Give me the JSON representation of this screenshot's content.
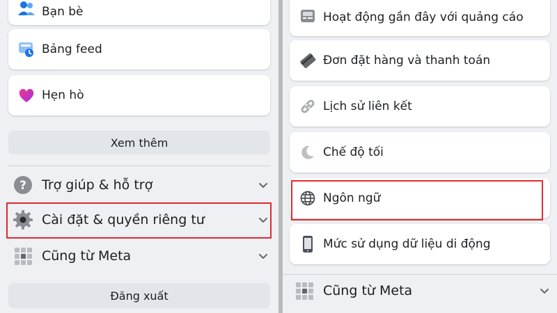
{
  "left": {
    "items": [
      {
        "label": "Bạn bè",
        "icon": "friends-icon"
      },
      {
        "label": "Bảng feed",
        "icon": "feed-icon"
      },
      {
        "label": "Hẹn hò",
        "icon": "dating-heart-icon"
      }
    ],
    "see_more": "Xem thêm",
    "sections": [
      {
        "label": "Trợ giúp & hỗ trợ",
        "icon": "help-icon"
      },
      {
        "label": "Cài đặt & quyền riêng tư",
        "icon": "gear-icon"
      },
      {
        "label": "Cũng từ Meta",
        "icon": "grid-icon"
      }
    ],
    "logout": "Đăng xuất"
  },
  "right": {
    "items": [
      {
        "label": "Hoạt động gần đây với quảng cáo",
        "icon": "ad-activity-icon"
      },
      {
        "label": "Đơn đặt hàng và thanh toán",
        "icon": "card-icon"
      },
      {
        "label": "Lịch sử liên kết",
        "icon": "link-icon"
      },
      {
        "label": "Chế độ tối",
        "icon": "moon-icon"
      },
      {
        "label": "Ngôn ngữ",
        "icon": "globe-icon"
      },
      {
        "label": "Mức sử dụng dữ liệu di động",
        "icon": "phone-icon"
      }
    ],
    "section": {
      "label": "Cũng từ Meta",
      "icon": "grid-icon"
    }
  },
  "colors": {
    "highlight": "#e0292f",
    "background": "#eef0f3",
    "card": "#ffffff",
    "button": "#e2e5e9"
  }
}
